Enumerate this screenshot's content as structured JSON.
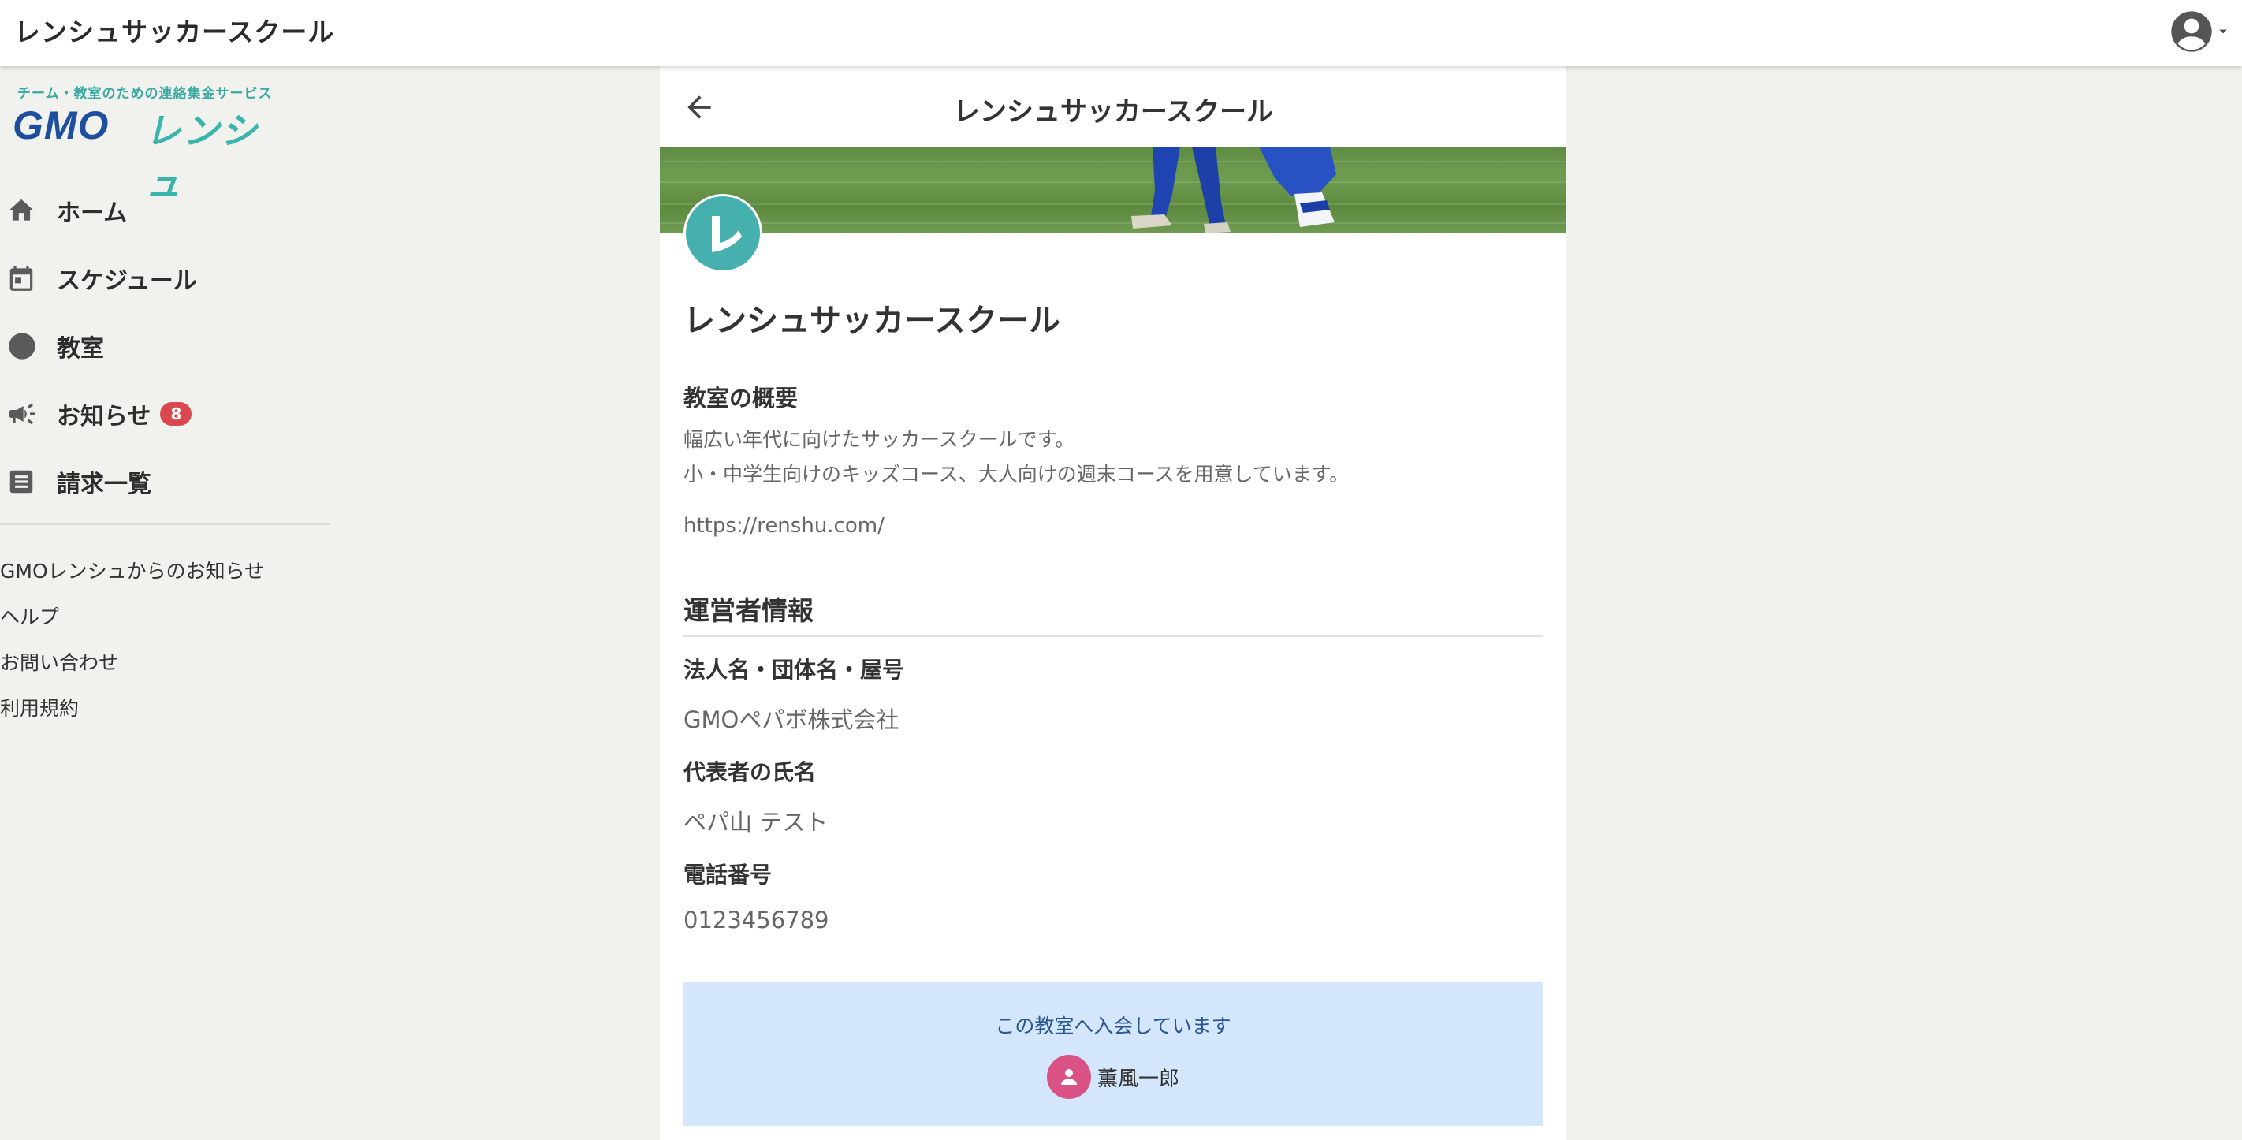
{
  "header": {
    "title": "レンシュサッカースクール"
  },
  "sidebar": {
    "logo": {
      "tagline": "チーム・教室のための連絡集金サービス",
      "brand_gmo": "GMO",
      "brand_name": "レンシュ"
    },
    "nav": [
      {
        "label": "ホーム",
        "icon": "home-icon"
      },
      {
        "label": "スケジュール",
        "icon": "calendar-icon"
      },
      {
        "label": "教室",
        "icon": "circle-icon"
      },
      {
        "label": "お知らせ",
        "icon": "megaphone-icon",
        "badge": "8"
      },
      {
        "label": "請求一覧",
        "icon": "invoice-list-icon"
      }
    ],
    "links": [
      {
        "label": "GMOレンシュからのお知らせ"
      },
      {
        "label": "ヘルプ"
      },
      {
        "label": "お問い合わせ"
      },
      {
        "label": "利用規約"
      }
    ]
  },
  "main": {
    "title": "レンシュサッカースクール",
    "avatar_letter": "レ",
    "school_name": "レンシュサッカースクール",
    "overview": {
      "heading": "教室の概要",
      "lines": [
        "幅広い年代に向けたサッカースクールです。",
        "小・中学生向けのキッズコース、大人向けの週末コースを用意しています。"
      ],
      "url": "https://renshu.com/"
    },
    "operator": {
      "heading": "運営者情報",
      "fields": [
        {
          "label": "法人名・団体名・屋号",
          "value": "GMOペパボ株式会社"
        },
        {
          "label": "代表者の氏名",
          "value": "ペパ山 テスト"
        },
        {
          "label": "電話番号",
          "value": "0123456789"
        }
      ]
    },
    "membership": {
      "message": "この教室へ入会しています",
      "member_name": "薫風一郎"
    }
  },
  "colors": {
    "teal_accent": "#45b0ad",
    "badge_red": "#d9484f",
    "member_box_bg": "#d3e6fb",
    "member_avatar": "#d95283",
    "page_bg": "#f1f1ed"
  }
}
